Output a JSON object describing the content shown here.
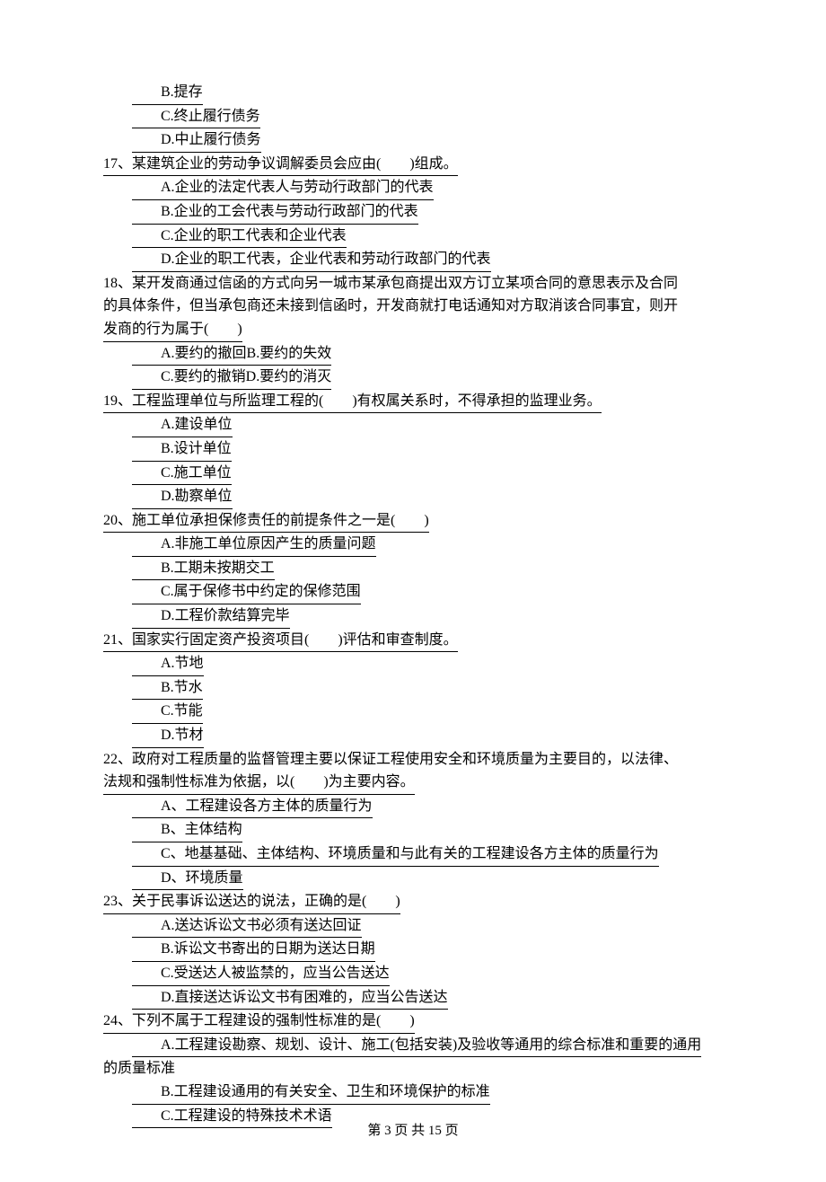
{
  "q16": {
    "B": "B.提存",
    "C": "C.终止履行债务",
    "D": "D.中止履行债务"
  },
  "q17": {
    "stem_a": "17、某建筑企业的劳动争议调解委员会应由(",
    "stem_b": ")组成。",
    "A": "A.企业的法定代表人与劳动行政部门的代表",
    "B": "B.企业的工会代表与劳动行政部门的代表",
    "C": "C.企业的职工代表和企业代表",
    "D": "D.企业的职工代表，企业代表和劳动行政部门的代表"
  },
  "q18": {
    "l1": "18、某开发商通过信函的方式向另一城市某承包商提出双方订立某项合同的意思表示及合同",
    "l2": "的具体条件，但当承包商还未接到信函时，开发商就打电话通知对方取消该合同事宜，则开",
    "l3_a": "发商的行为属于(",
    "l3_b": ")",
    "AB": "A.要约的撤回B.要约的失效",
    "CD": "C.要约的撤销D.要约的消灭"
  },
  "q19": {
    "stem_a": "19、工程监理单位与所监理工程的(",
    "stem_b": ")有权属关系时，不得承担的监理业务。",
    "A": "A.建设单位",
    "B": "B.设计单位",
    "C": "C.施工单位",
    "D": "D.勘察单位"
  },
  "q20": {
    "stem_a": "20、施工单位承担保修责任的前提条件之一是(",
    "stem_b": ")",
    "A": "A.非施工单位原因产生的质量问题",
    "B": "B.工期未按期交工",
    "C": "C.属于保修书中约定的保修范围",
    "D": "D.工程价款结算完毕"
  },
  "q21": {
    "stem_a": "21、国家实行固定资产投资项目(",
    "stem_b": ")评估和审查制度。",
    "A": "A.节地",
    "B": "B.节水",
    "C": "C.节能",
    "D": "D.节材"
  },
  "q22": {
    "l1": "22、政府对工程质量的监督管理主要以保证工程使用安全和环境质量为主要目的，以法律、",
    "l2_a": "法规和强制性标准为依据，以(",
    "l2_b": ")为主要内容。",
    "A": "A、工程建设各方主体的质量行为",
    "B": "B、主体结构",
    "C": "C、地基基础、主体结构、环境质量和与此有关的工程建设各方主体的质量行为",
    "D": "D、环境质量"
  },
  "q23": {
    "stem_a": "23、关于民事诉讼送达的说法，正确的是(",
    "stem_b": ")",
    "A": "A.送达诉讼文书必须有送达回证",
    "B": "B.诉讼文书寄出的日期为送达日期",
    "C": "C.受送达人被监禁的，应当公告送达",
    "D": "D.直接送达诉讼文书有困难的，应当公告送达"
  },
  "q24": {
    "stem_a": "24、下列不属于工程建设的强制性标准的是(",
    "stem_b": ")",
    "A_l1": "A.工程建设勘察、规划、设计、施工(包括安装)及验收等通用的综合标准和重要的通用",
    "A_l2": "的质量标准",
    "B": "B.工程建设通用的有关安全、卫生和环境保护的标准",
    "C": "C.工程建设的特殊技术术语"
  },
  "footer": "第 3 页 共 15 页"
}
